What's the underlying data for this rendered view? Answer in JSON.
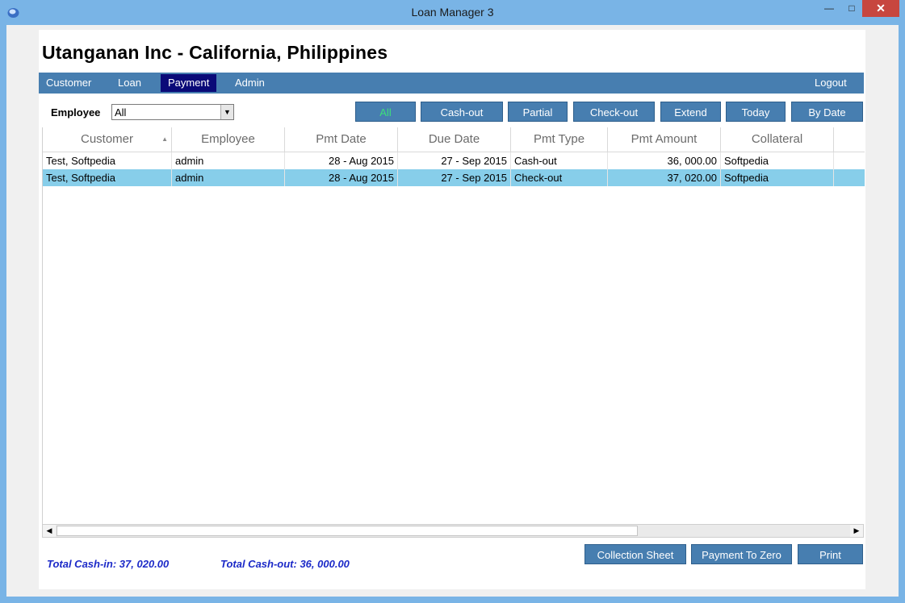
{
  "window": {
    "title": "Loan Manager 3",
    "minimize": "—",
    "maximize": "□",
    "close": "✕"
  },
  "company": "Utanganan Inc - California, Philippines",
  "menu": {
    "customer": "Customer",
    "loan": "Loan",
    "payment": "Payment",
    "admin": "Admin",
    "logout": "Logout"
  },
  "filter": {
    "label": "Employee",
    "value": "All"
  },
  "filter_buttons": {
    "all": "All",
    "cashout": "Cash-out",
    "partial": "Partial",
    "checkout": "Check-out",
    "extend": "Extend",
    "today": "Today",
    "bydate": "By Date"
  },
  "table": {
    "headers": [
      "Customer",
      "Employee",
      "Pmt Date",
      "Due Date",
      "Pmt Type",
      "Pmt Amount",
      "Collateral"
    ],
    "rows": [
      {
        "customer": "Test, Softpedia",
        "employee": "admin",
        "pmt_date": "28 - Aug  2015",
        "due_date": "27 - Sep  2015",
        "pmt_type": "Cash-out",
        "pmt_amount": "36, 000.00",
        "collateral": "Softpedia"
      },
      {
        "customer": "Test, Softpedia",
        "employee": "admin",
        "pmt_date": "28 - Aug  2015",
        "due_date": "27 - Sep  2015",
        "pmt_type": "Check-out",
        "pmt_amount": "37, 020.00",
        "collateral": "Softpedia"
      }
    ]
  },
  "totals": {
    "cash_in": "Total Cash-in: 37, 020.00",
    "cash_out": "Total Cash-out: 36, 000.00"
  },
  "bottom_buttons": {
    "collection_sheet": "Collection Sheet",
    "payment_to_zero": "Payment To Zero",
    "print": "Print"
  },
  "colors": {
    "titlebar": "#79b4e6",
    "menubar": "#477eb0",
    "active_menu": "#0a0a78",
    "selected_row": "#87ceea",
    "totals_text": "#1c2ac8",
    "close_button": "#c7463f"
  }
}
